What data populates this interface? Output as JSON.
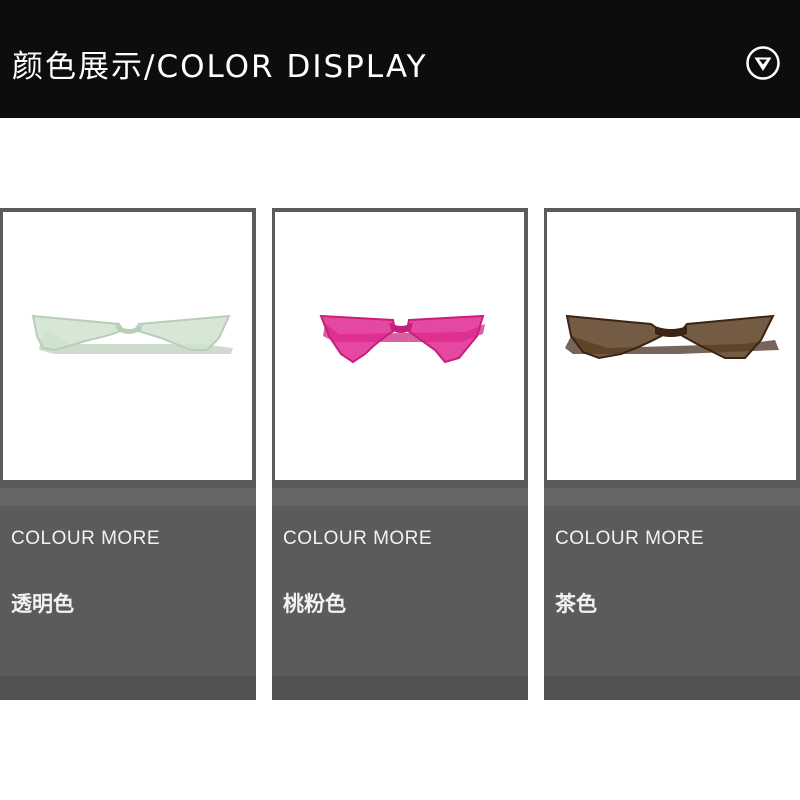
{
  "header": {
    "title": "颜色展示/COLOR  DISPLAY",
    "icon": "chevron-down-circle-icon"
  },
  "colors": {
    "header_bg": "#0d0d0d",
    "card_bg": "#5b5b5b"
  },
  "cards": [
    {
      "colour_label": "COLOUR  MORE",
      "name": "透明色",
      "lens_color": "#cfe3cf",
      "frame_color": "#b9cdb9"
    },
    {
      "colour_label": "COLOUR  MORE",
      "name": "桃粉色",
      "lens_color": "#e0288f",
      "frame_color": "#c81e7c"
    },
    {
      "colour_label": "COLOUR  MORE",
      "name": "茶色",
      "lens_color": "#5a3f22",
      "frame_color": "#3b2414"
    }
  ]
}
